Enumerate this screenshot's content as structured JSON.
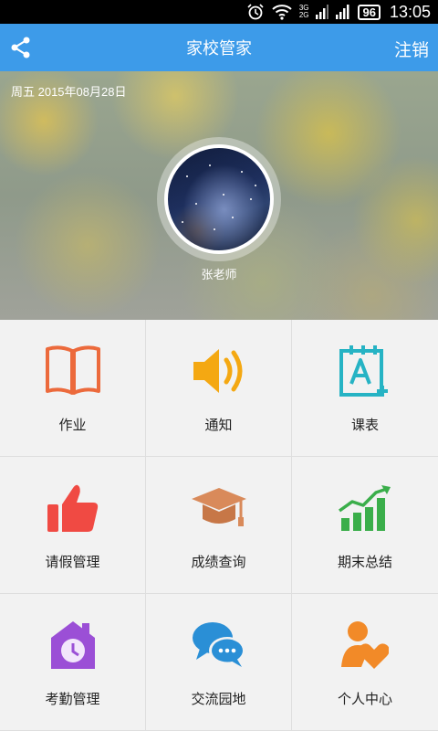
{
  "status_bar": {
    "network_top": "3G",
    "network_bottom": "2G",
    "battery": "96",
    "time": "13:05"
  },
  "header": {
    "title": "家校管家",
    "logout_label": "注销",
    "share_icon": "share-icon"
  },
  "banner": {
    "date": "周五 2015年08月28日",
    "user_name": "张老师"
  },
  "menu": [
    {
      "label": "作业",
      "icon": "book-icon",
      "color": "#ec6a3c"
    },
    {
      "label": "通知",
      "icon": "speaker-icon",
      "color": "#f4a812"
    },
    {
      "label": "课表",
      "icon": "schedule-icon",
      "color": "#26b3c4"
    },
    {
      "label": "请假管理",
      "icon": "thumbs-up-icon",
      "color": "#f04a43"
    },
    {
      "label": "成绩查询",
      "icon": "graduation-cap-icon",
      "color": "#d98a5a"
    },
    {
      "label": "期末总结",
      "icon": "bar-chart-icon",
      "color": "#3aae4a"
    },
    {
      "label": "考勤管理",
      "icon": "clock-house-icon",
      "color": "#9b4fd6"
    },
    {
      "label": "交流园地",
      "icon": "chat-bubbles-icon",
      "color": "#2a8fd6"
    },
    {
      "label": "个人中心",
      "icon": "user-heart-icon",
      "color": "#f28a28"
    }
  ]
}
